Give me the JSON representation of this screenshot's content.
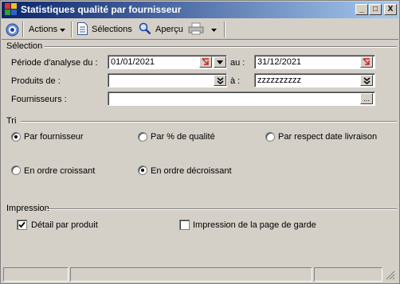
{
  "window": {
    "title": "Statistiques qualité par fournisseur"
  },
  "titlebar_buttons": {
    "minimize": "_",
    "maximize": "□",
    "close": "X"
  },
  "toolbar": {
    "actions_label": "Actions",
    "selections_label": "Sélections",
    "preview_label": "Aperçu"
  },
  "selection": {
    "title": "Sélection",
    "period_label": "Période d'analyse du :",
    "period_from": "01/01/2021",
    "period_to_label": "au :",
    "period_to": "31/12/2021",
    "products_label": "Produits de :",
    "products_from": "",
    "products_to_label": "à :",
    "products_to": "zzzzzzzzzz",
    "suppliers_label": "Fournisseurs :",
    "suppliers_value": "",
    "ellipsis": "..."
  },
  "sort": {
    "title": "Tri",
    "options": [
      {
        "label": "Par fournisseur",
        "selected": true
      },
      {
        "label": "Par % de qualité",
        "selected": false
      },
      {
        "label": "Par respect date livraison",
        "selected": false
      }
    ],
    "order": [
      {
        "label": "En ordre croissant",
        "selected": false
      },
      {
        "label": "En ordre décroissant",
        "selected": true
      }
    ]
  },
  "print": {
    "title": "Impression",
    "detail_label": "Détail par produit",
    "detail_checked": true,
    "cover_label": "Impression de la page de garde",
    "cover_checked": false
  },
  "colors": {
    "title_start": "#0a246a",
    "title_end": "#a6caf0",
    "face": "#d4d0c8"
  }
}
